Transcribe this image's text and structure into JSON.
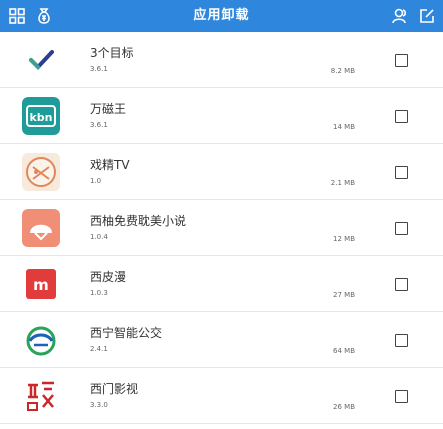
{
  "header": {
    "title": "应用卸载",
    "left_icons": [
      "grid-icon",
      "money-bag-icon"
    ],
    "right_icons": [
      "user-icon",
      "edit-icon"
    ],
    "bar_color": "#2f86dd"
  },
  "apps": [
    {
      "name": "3个目标",
      "version": "3.6.1",
      "size": "8.2 MB",
      "icon": "checkmark-icon",
      "checked": false
    },
    {
      "name": "万磁王",
      "version": "3.6.1",
      "size": "14 MB",
      "icon": "kbn-logo-icon",
      "checked": false
    },
    {
      "name": "戏精TV",
      "version": "1.0",
      "size": "2.1 MB",
      "icon": "mask-logo-icon",
      "checked": false
    },
    {
      "name": "西柚免费耽美小说",
      "version": "1.0.4",
      "size": "12 MB",
      "icon": "dome-logo-icon",
      "checked": false
    },
    {
      "name": "西皮漫",
      "version": "1.0.3",
      "size": "27 MB",
      "icon": "m-logo-icon",
      "checked": false
    },
    {
      "name": "西宁智能公交",
      "version": "2.4.1",
      "size": "64 MB",
      "icon": "bus-swirl-logo-icon",
      "checked": false
    },
    {
      "name": "西门影视",
      "version": "3.3.0",
      "size": "26 MB",
      "icon": "calligraphy-logo-icon",
      "checked": false
    }
  ]
}
